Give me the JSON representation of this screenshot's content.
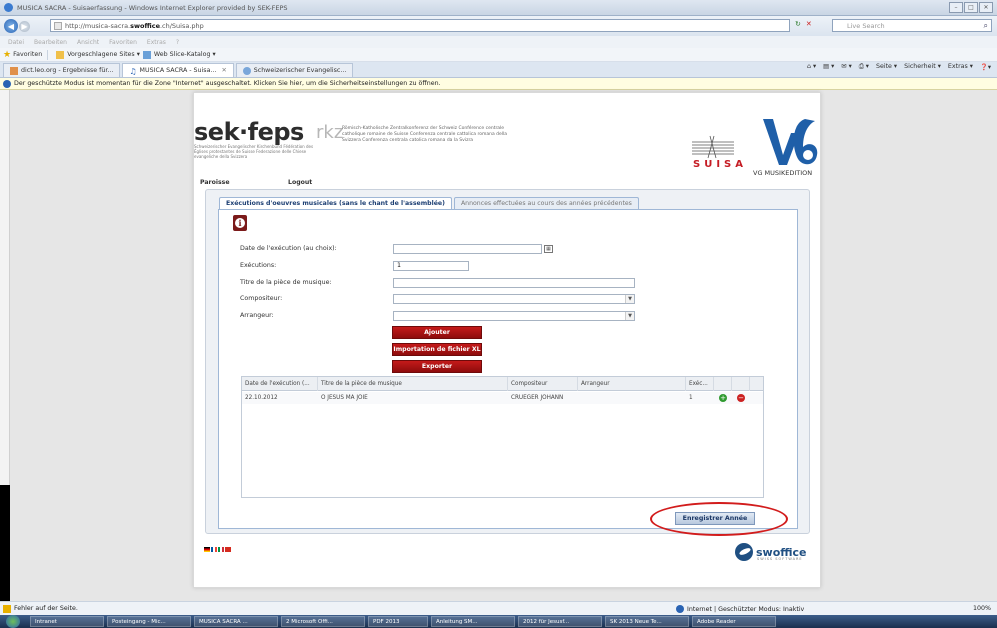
{
  "window": {
    "title": "MUSICA SACRA - Suisaerfassung - Windows Internet Explorer provided by SEK-FEPS",
    "controls": [
      "–",
      "□",
      "✕"
    ]
  },
  "address": {
    "url_prefix": "http://musica-sacra.",
    "url_domain": "swoffice",
    "url_suffix": ".ch/Suisa.php",
    "search_placeholder": "Live Search"
  },
  "menu": [
    "Datei",
    "Bearbeiten",
    "Ansicht",
    "Favoriten",
    "Extras",
    "?"
  ],
  "favorites": {
    "label": "Favoriten",
    "items": [
      "Vorgeschlagene Sites ▾",
      "Web Slice-Katalog ▾"
    ]
  },
  "browser_tabs": [
    {
      "label": "dict.leo.org - Ergebnisse für...",
      "active": false
    },
    {
      "label": "MUSICA SACRA - Suisa...",
      "active": true
    },
    {
      "label": "Schweizerischer Evangelisc...",
      "active": false
    }
  ],
  "command_bar": [
    "Seite ▾",
    "Sicherheit ▾",
    "Extras ▾"
  ],
  "info_bar": "Der geschützte Modus ist momentan für die Zone \"Internet\" ausgeschaltet. Klicken Sie hier, um die Sicherheitseinstellungen zu öffnen.",
  "header": {
    "sek_logo": "sek·feps",
    "sek_subtitle": "Schweizerischer Evangelischer Kirchenbund Fédération des Églises protestantes de Suisse Federazione delle Chiese evangeliche della Svizzera",
    "rkz_logo": "rkz",
    "rkz_subtitle": "Römisch-Katholische Zentralkonferenz der Schweiz Conférence centrale catholique romaine de Suisse Conferenza centrale cattolica romana della Svizzera Conferenza centrala catolica romana da la Svizra",
    "suisa": "SUISA",
    "vg": "VG MUSIKEDITION"
  },
  "page_nav": {
    "paroisse": "Paroisse",
    "logout": "Logout"
  },
  "tabs": [
    {
      "label": "Exécutions d'oeuvres musicales (sans le chant de l'assemblée)",
      "active": true
    },
    {
      "label": "Annonces effectuées au cours des années précédentes",
      "active": false
    }
  ],
  "form": {
    "date_label": "Date de l'exécution (au choix):",
    "date_value": "",
    "executions_label": "Exécutions:",
    "executions_value": "1",
    "title_label": "Titre de la pièce de musique:",
    "title_value": "",
    "composer_label": "Compositeur:",
    "composer_value": "",
    "arranger_label": "Arrangeur:",
    "arranger_value": ""
  },
  "buttons": {
    "add": "Ajouter",
    "import": "Importation de fichier XL",
    "export": "Exporter",
    "save_year": "Enregistrer Année"
  },
  "table": {
    "columns": [
      "Date de l'exécution (...",
      "Titre de la pièce de musique",
      "Compositeur",
      "Arrangeur",
      "Exéc..."
    ],
    "rows": [
      {
        "date": "22.10.2012",
        "title": "O JESUS MA JOIE",
        "composer": "CRUEGER JOHANN",
        "arranger": "",
        "executions": "1"
      }
    ]
  },
  "footer": {
    "swoffice": "swoffice",
    "swoffice_sub": "SWISS SOFTWARE"
  },
  "status": {
    "left": "Fehler auf der Seite.",
    "zone": "Internet | Geschützter Modus: Inaktiv",
    "zoom": "100%"
  },
  "taskbar": [
    "Intranet",
    "Posteingang - Mic...",
    "MUSICA SACRA ...",
    "2 Microsoft Offi...",
    "PDF 2013",
    "Anleitung SM...",
    "2012 für Jesusf...",
    "SK 2013 Neue Te...",
    "Adobe Reader"
  ],
  "colors": {
    "brand_red": "#c51a1a",
    "highlight_ellipse": "#d21c1c",
    "tab_text": "#1d3f73",
    "swoffice_blue": "#1f4f82"
  }
}
